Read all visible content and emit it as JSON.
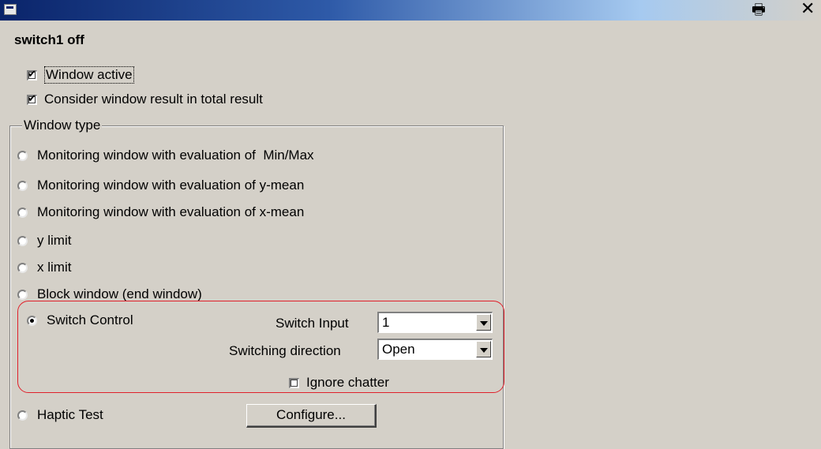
{
  "window": {
    "title": "switch1 off"
  },
  "checkboxes": {
    "window_active": {
      "label": "Window active",
      "checked": true
    },
    "consider_result": {
      "label": "Consider window result in total result",
      "checked": true
    }
  },
  "window_type": {
    "legend": "Window type",
    "options": [
      {
        "label": "Monitoring window with evaluation of  Min/Max",
        "selected": false
      },
      {
        "label": "Monitoring window with evaluation of y-mean",
        "selected": false
      },
      {
        "label": "Monitoring window with evaluation of x-mean",
        "selected": false
      },
      {
        "label": "y limit",
        "selected": false
      },
      {
        "label": "x limit",
        "selected": false
      },
      {
        "label": "Block window (end window)",
        "selected": false
      },
      {
        "label": "Switch Control",
        "selected": true
      },
      {
        "label": "Haptic Test",
        "selected": false
      }
    ]
  },
  "switch_control": {
    "switch_input_label": "Switch Input",
    "switch_input_value": "1",
    "switching_direction_label": "Switching direction",
    "switching_direction_value": "Open",
    "ignore_chatter_label": "Ignore chatter",
    "ignore_chatter_checked": false
  },
  "haptic": {
    "configure_label": "Configure..."
  },
  "icons": {
    "app": "app-icon",
    "print": "print-icon",
    "close": "close-icon",
    "dropdown": "chevron-down-icon"
  },
  "colors": {
    "highlight": "#e0202a",
    "titlebar": "#0a246a",
    "face": "#d4d0c8"
  }
}
